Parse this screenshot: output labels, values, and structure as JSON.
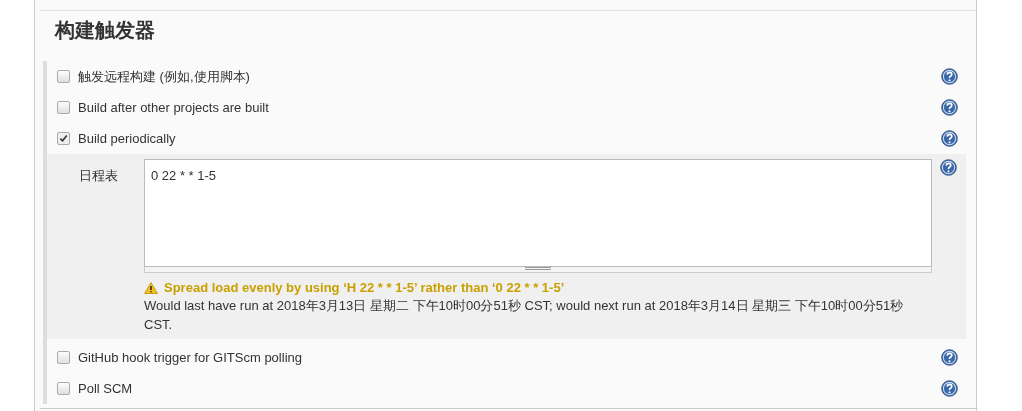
{
  "section_title": "构建触发器",
  "triggers": [
    {
      "label": "触发远程构建 (例如,使用脚本)",
      "checked": false
    },
    {
      "label": "Build after other projects are built",
      "checked": false
    },
    {
      "label": "Build periodically",
      "checked": true,
      "schedule": {
        "label": "日程表",
        "value": "0 22 * * 1-5",
        "warning": "Spread load evenly by using ‘H 22 * * 1-5’ rather than ‘0 22 * * 1-5’",
        "message": "Would last have run at 2018年3月13日 星期二 下午10时00分51秒 CST; would next run at 2018年3月14日 星期三 下午10时00分51秒 CST."
      }
    },
    {
      "label": "GitHub hook trigger for GITScm polling",
      "checked": false
    },
    {
      "label": "Poll SCM",
      "checked": false
    }
  ]
}
